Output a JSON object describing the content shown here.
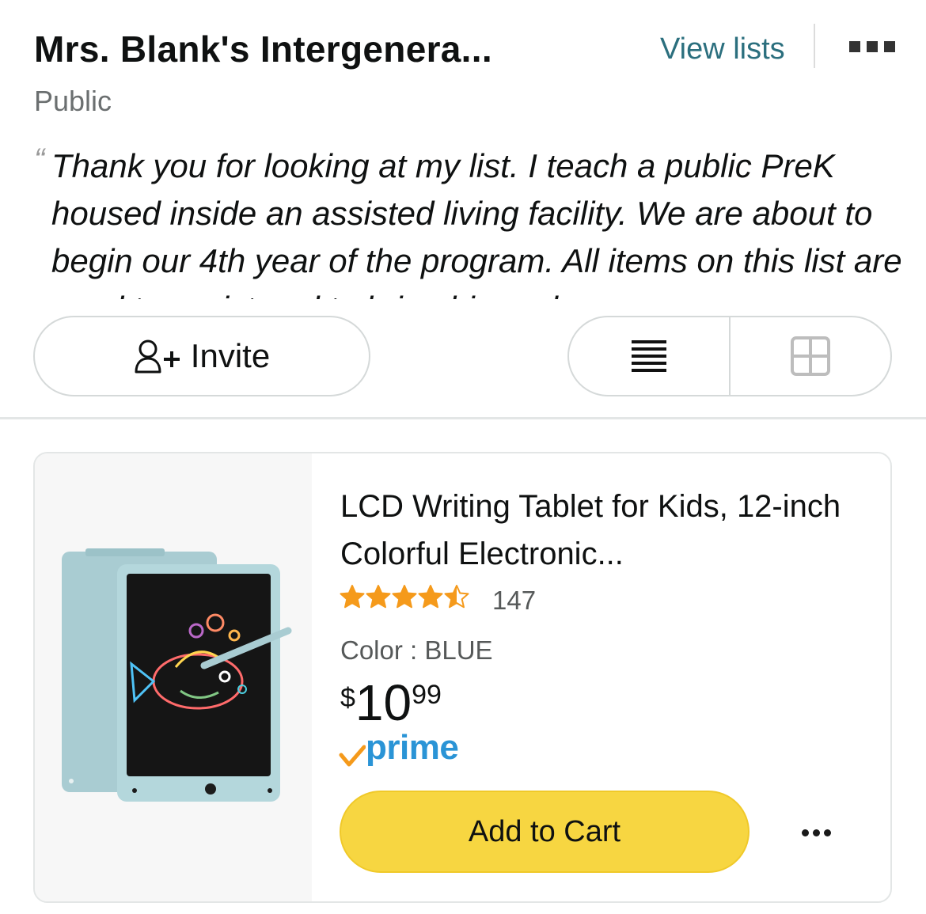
{
  "header": {
    "title": "Mrs. Blank's Intergenera...",
    "view_lists_label": "View lists",
    "more_icon": "more-options-icon",
    "privacy": "Public"
  },
  "description": {
    "quote_mark": "“",
    "text": "Thank you for looking at my list. I teach a public PreK housed inside an assisted living facility. We are about to begin our 4th year of the program. All items on this list are used to assist and to bring big and"
  },
  "actions": {
    "invite_label": "Invite",
    "invite_icon": "add-person-icon",
    "list_view_icon": "list-view-icon",
    "grid_view_icon": "grid-view-icon"
  },
  "item": {
    "title": "LCD Writing Tablet for Kids, 12-inch Colorful Electronic...",
    "rating": 4.5,
    "review_count": "147",
    "color_line": "Color : BLUE",
    "price": {
      "symbol": "$",
      "whole": "10",
      "fraction": "99"
    },
    "prime_label": "prime",
    "add_to_cart_label": "Add to Cart",
    "more_icon": "more-options-icon"
  },
  "colors": {
    "link": "#2b6f7e",
    "star": "#f59a1b",
    "cart_button": "#f7d641",
    "prime_blue": "#2a94d6",
    "prime_check": "#f59a1b"
  }
}
